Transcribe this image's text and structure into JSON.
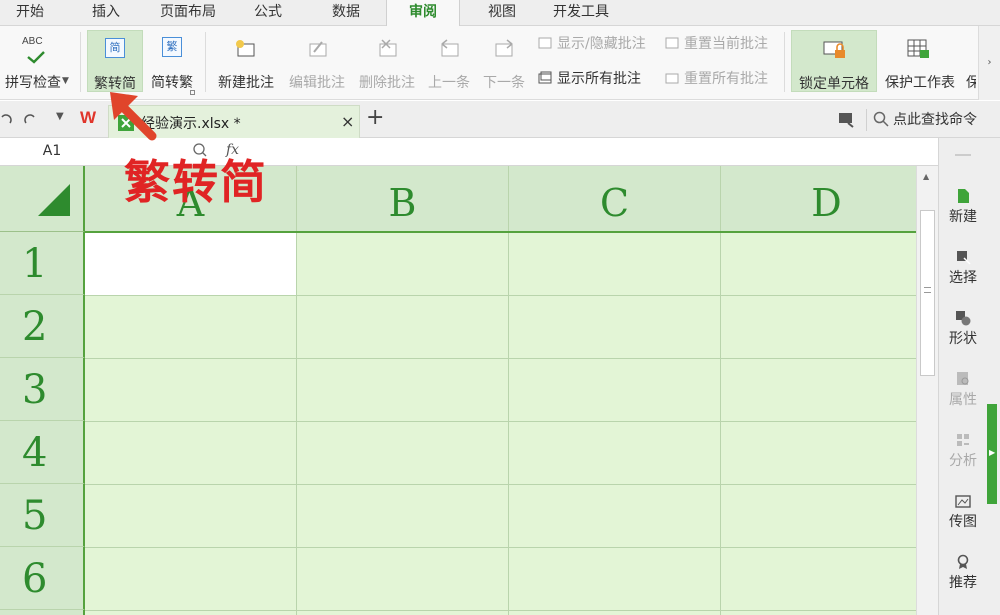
{
  "menu": {
    "tabs": [
      {
        "label": "开始"
      },
      {
        "label": "插入"
      },
      {
        "label": "页面布局"
      },
      {
        "label": "公式"
      },
      {
        "label": "数据"
      },
      {
        "label": "审阅"
      },
      {
        "label": "视图"
      },
      {
        "label": "开发工具"
      }
    ],
    "active": "审阅"
  },
  "ribbon": {
    "spellcheck": "拼写检查",
    "spellcheck_icon_text": "ABC",
    "trad_to_simp": "繁转简",
    "simp_to_trad": "简转繁",
    "trad_icon_char": "简",
    "simp_icon_char": "繁",
    "new_comment": "新建批注",
    "edit_comment": "编辑批注",
    "delete_comment": "删除批注",
    "prev": "上一条",
    "next": "下一条",
    "show_hide_comment": "显示/隐藏批注",
    "show_all_comments": "显示所有批注",
    "reset_current_comment": "重置当前批注",
    "reset_all_comments": "重置所有批注",
    "lock_cell": "锁定单元格",
    "protect_sheet": "保护工作表",
    "truncated_next": "保"
  },
  "tabbar": {
    "wps_logo": "W",
    "file_name": "经验演示.xlsx *",
    "close": "×",
    "new_tab": "+",
    "search": "点此查找命令"
  },
  "formula_bar": {
    "name_box": "A1",
    "fx": "fx"
  },
  "sheet": {
    "columns": [
      "A",
      "B",
      "C",
      "D"
    ],
    "rows": [
      "1",
      "2",
      "3",
      "4",
      "5",
      "6"
    ]
  },
  "task_pane": {
    "items": [
      {
        "label": "新建",
        "enabled": true
      },
      {
        "label": "选择",
        "enabled": true
      },
      {
        "label": "形状",
        "enabled": true
      },
      {
        "label": "属性",
        "enabled": false
      },
      {
        "label": "分析",
        "enabled": false
      },
      {
        "label": "传图",
        "enabled": true
      },
      {
        "label": "推荐",
        "enabled": true
      }
    ]
  },
  "annotation": {
    "text": "繁转简"
  },
  "colors": {
    "accent": "#2e8b2e",
    "grid_bg": "#e3f5d6",
    "header_bg": "#d3e8cc",
    "annotation": "#e02424"
  }
}
